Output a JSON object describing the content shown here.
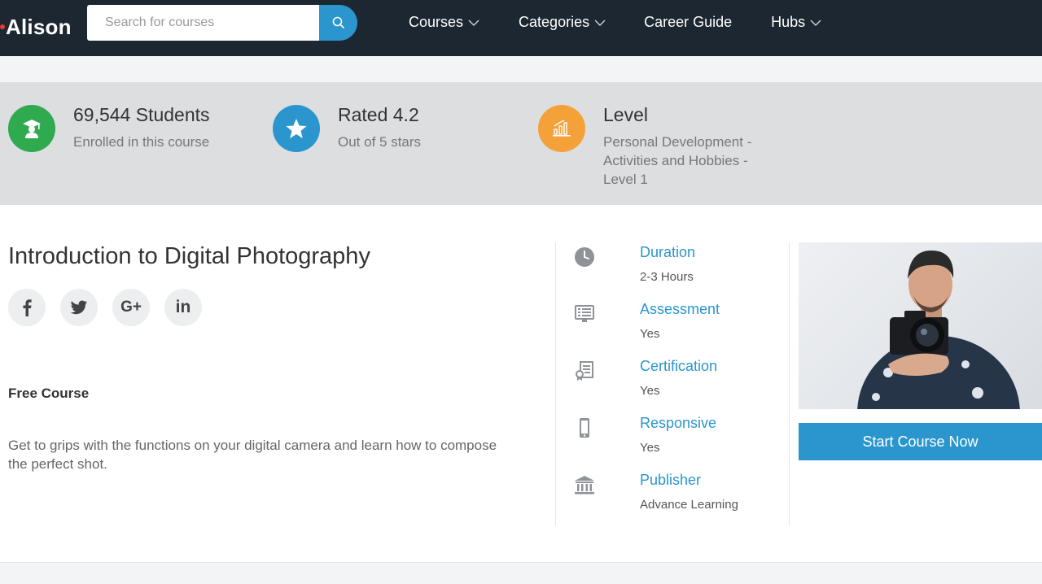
{
  "header": {
    "logo_text": "Alison",
    "search": {
      "placeholder": "Search for courses",
      "value": ""
    },
    "nav": [
      {
        "label": "Courses",
        "has_dropdown": true
      },
      {
        "label": "Categories",
        "has_dropdown": true
      },
      {
        "label": "Career Guide",
        "has_dropdown": false
      },
      {
        "label": "Hubs",
        "has_dropdown": true
      }
    ]
  },
  "stats": {
    "students": {
      "title": "69,544 Students",
      "subtitle": "Enrolled in this course",
      "icon": "graduate-icon",
      "color": "#2faa4f"
    },
    "rating": {
      "title": "Rated 4.2",
      "subtitle": "Out of 5 stars",
      "icon": "star-icon",
      "color": "#2a96cd"
    },
    "level": {
      "title": "Level",
      "subtitle_lines": [
        "Personal Development -",
        "Activities and Hobbies -",
        "Level 1"
      ],
      "icon": "bar-chart-icon",
      "color": "#f4a13a"
    }
  },
  "course": {
    "title": "Introduction to Digital Photography",
    "socials": [
      {
        "name": "facebook",
        "glyph": "f"
      },
      {
        "name": "twitter",
        "glyph": "t"
      },
      {
        "name": "google-plus",
        "glyph": "G+"
      },
      {
        "name": "linkedin",
        "glyph": "in"
      }
    ],
    "price_label": "Free Course",
    "description": "Get to grips with the functions on your digital camera and learn how to compose the perfect shot."
  },
  "details": [
    {
      "label": "Duration",
      "value": "2-3 Hours",
      "icon": "clock-icon"
    },
    {
      "label": "Assessment",
      "value": "Yes",
      "icon": "assessment-icon"
    },
    {
      "label": "Certification",
      "value": "Yes",
      "icon": "certificate-icon"
    },
    {
      "label": "Responsive",
      "value": "Yes",
      "icon": "mobile-icon"
    },
    {
      "label": "Publisher",
      "value": "Advance Learning",
      "icon": "institution-icon"
    }
  ],
  "cta": {
    "label": "Start Course Now"
  },
  "colors": {
    "accent": "#2a96cd",
    "nav_bg": "#1d2731",
    "band_bg": "#dcdee0"
  }
}
